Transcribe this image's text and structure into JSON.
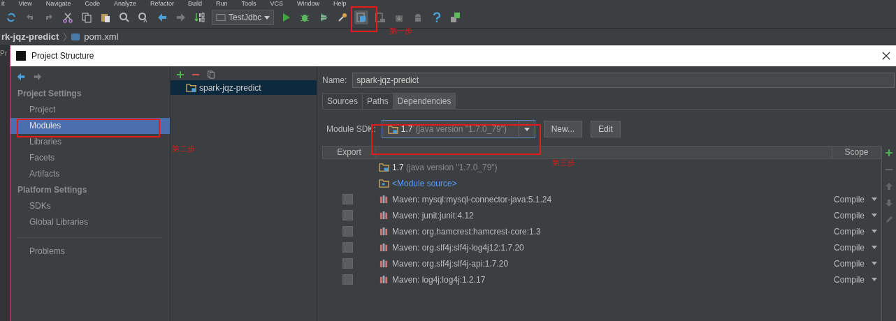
{
  "menu_bar": {
    "items": [
      "it",
      "View",
      "Navigate",
      "Code",
      "Analyze",
      "Refactor",
      "Build",
      "Run",
      "Tools",
      "VCS",
      "Window",
      "Help"
    ]
  },
  "toolbar": {
    "run_configuration": "TestJdbc"
  },
  "breadcrumb": [
    "rk-jqz-predict",
    "pom.xml"
  ],
  "editor_strip": {
    "label": "Pr"
  },
  "dialog": {
    "title": "Project Structure"
  },
  "sidebar": {
    "sections": [
      {
        "title": "Project Settings",
        "items": [
          {
            "label": "Project",
            "selected": false
          },
          {
            "label": "Modules",
            "selected": true
          },
          {
            "label": "Libraries",
            "selected": false
          },
          {
            "label": "Facets",
            "selected": false
          },
          {
            "label": "Artifacts",
            "selected": false
          }
        ]
      },
      {
        "title": "Platform Settings",
        "items": [
          {
            "label": "SDKs",
            "selected": false
          },
          {
            "label": "Global Libraries",
            "selected": false
          }
        ]
      }
    ],
    "extra_items": [
      {
        "label": "Problems",
        "selected": false
      }
    ]
  },
  "modules": [
    {
      "name": "spark-jqz-predict",
      "selected": true
    }
  ],
  "name_field": {
    "label": "Name:",
    "value": "spark-jqz-predict"
  },
  "tabs": [
    {
      "label": "Sources",
      "selected": false
    },
    {
      "label": "Paths",
      "selected": false
    },
    {
      "label": "Dependencies",
      "selected": true
    }
  ],
  "module_sdk": {
    "label": "Module SDK:",
    "value": "1.7",
    "detail": "(java version \"1.7.0_79\")",
    "buttons": [
      "New...",
      "Edit"
    ]
  },
  "dependencies": {
    "columns": [
      "Export",
      "Scope"
    ],
    "rows": [
      {
        "kind": "sdk",
        "label": "1.7",
        "detail": "(java version \"1.7.0_79\")"
      },
      {
        "kind": "source",
        "label": "<Module source>"
      },
      {
        "kind": "library",
        "label": "Maven: mysql:mysql-connector-java:5.1.24",
        "scope": "Compile",
        "checked": false
      },
      {
        "kind": "library",
        "label": "Maven: junit:junit:4.12",
        "scope": "Compile",
        "checked": false
      },
      {
        "kind": "library",
        "label": "Maven: org.hamcrest:hamcrest-core:1.3",
        "scope": "Compile",
        "checked": false
      },
      {
        "kind": "library",
        "label": "Maven: org.slf4j:slf4j-log4j12:1.7.20",
        "scope": "Compile",
        "checked": false
      },
      {
        "kind": "library",
        "label": "Maven: org.slf4j:slf4j-api:1.7.20",
        "scope": "Compile",
        "checked": false
      },
      {
        "kind": "library",
        "label": "Maven: log4j:log4j:1.2.17",
        "scope": "Compile",
        "checked": false
      }
    ]
  },
  "annotations": [
    "第一步",
    "第二步",
    "第三步"
  ]
}
